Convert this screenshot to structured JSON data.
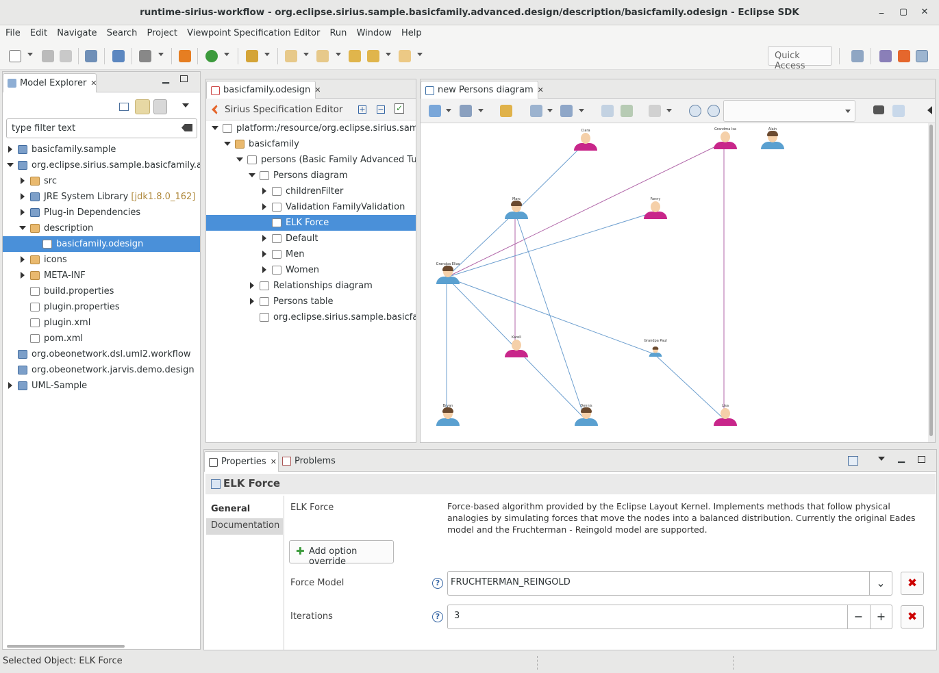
{
  "window": {
    "title": "runtime-sirius-workflow - org.eclipse.sirius.sample.basicfamily.advanced.design/description/basicfamily.odesign - Eclipse SDK",
    "controls": [
      "minimize",
      "maximize",
      "close"
    ]
  },
  "menu": [
    "File",
    "Edit",
    "Navigate",
    "Search",
    "Project",
    "Viewpoint Specification Editor",
    "Run",
    "Window",
    "Help"
  ],
  "toolbar": {
    "quick_access_placeholder": "Quick Access"
  },
  "model_explorer": {
    "tab_label": "Model Explorer",
    "filter_placeholder": "type filter text",
    "tree": [
      {
        "label": "basicfamily.sample",
        "depth": 0,
        "expander": "collapsed",
        "icon": "project-icon"
      },
      {
        "label": "org.eclipse.sirius.sample.basicfamily.advanced",
        "depth": 0,
        "expander": "expanded",
        "icon": "plugin-project-icon"
      },
      {
        "label": "src",
        "depth": 1,
        "expander": "collapsed",
        "icon": "source-folder-icon"
      },
      {
        "label": "JRE System Library",
        "suffix": "[jdk1.8.0_162]",
        "depth": 1,
        "expander": "collapsed",
        "icon": "library-icon"
      },
      {
        "label": "Plug-in Dependencies",
        "depth": 1,
        "expander": "collapsed",
        "icon": "library-icon"
      },
      {
        "label": "description",
        "depth": 1,
        "expander": "expanded",
        "icon": "folder-icon"
      },
      {
        "label": "basicfamily.odesign",
        "depth": 2,
        "expander": "none",
        "icon": "odesign-file-icon",
        "selected": true
      },
      {
        "label": "icons",
        "depth": 1,
        "expander": "collapsed",
        "icon": "folder-icon"
      },
      {
        "label": "META-INF",
        "depth": 1,
        "expander": "collapsed",
        "icon": "folder-icon"
      },
      {
        "label": "build.properties",
        "depth": 1,
        "expander": "none",
        "icon": "properties-file-icon"
      },
      {
        "label": "plugin.properties",
        "depth": 1,
        "expander": "none",
        "icon": "properties-file-icon"
      },
      {
        "label": "plugin.xml",
        "depth": 1,
        "expander": "none",
        "icon": "xml-file-icon"
      },
      {
        "label": "pom.xml",
        "depth": 1,
        "expander": "none",
        "icon": "xml-file-icon"
      },
      {
        "label": "org.obeonetwork.dsl.uml2.workflow",
        "depth": 0,
        "expander": "none",
        "icon": "project-icon"
      },
      {
        "label": "org.obeonetwork.jarvis.demo.design",
        "depth": 0,
        "expander": "none",
        "icon": "project-icon"
      },
      {
        "label": "UML-Sample",
        "depth": 0,
        "expander": "collapsed",
        "icon": "project-icon"
      }
    ]
  },
  "odesign_editor": {
    "tab_label": "basicfamily.odesign",
    "header": "Sirius Specification Editor",
    "tree": [
      {
        "label": "platform:/resource/org.eclipse.sirius.sample.basicfamily.advanced.design/description/basicfamily.odesign",
        "depth": 0,
        "expander": "expanded",
        "icon": "odesign-file-icon"
      },
      {
        "label": "basicfamily",
        "depth": 1,
        "expander": "expanded",
        "icon": "group-folder-icon"
      },
      {
        "label": "persons (Basic Family Advanced Tutorial)",
        "depth": 2,
        "expander": "expanded",
        "icon": "viewpoint-icon"
      },
      {
        "label": "Persons diagram",
        "depth": 3,
        "expander": "expanded",
        "icon": "diagram-description-icon"
      },
      {
        "label": "childrenFilter",
        "depth": 4,
        "expander": "collapsed",
        "icon": "filter-icon"
      },
      {
        "label": "Validation FamilyValidation",
        "depth": 4,
        "expander": "collapsed",
        "icon": "validation-icon"
      },
      {
        "label": "ELK Force",
        "depth": 4,
        "expander": "none",
        "icon": "layout-icon",
        "selected": true
      },
      {
        "label": "Default",
        "depth": 4,
        "expander": "collapsed",
        "icon": "layer-icon"
      },
      {
        "label": "Men",
        "depth": 4,
        "expander": "collapsed",
        "icon": "layer-icon"
      },
      {
        "label": "Women",
        "depth": 4,
        "expander": "collapsed",
        "icon": "layer-icon"
      },
      {
        "label": "Relationships diagram",
        "depth": 3,
        "expander": "collapsed",
        "icon": "diagram-description-icon"
      },
      {
        "label": "Persons table",
        "depth": 3,
        "expander": "collapsed",
        "icon": "table-description-icon"
      },
      {
        "label": "org.eclipse.sirius.sample.basicfamily.advanced.design.Services",
        "depth": 3,
        "expander": "none",
        "icon": "java-extension-icon"
      }
    ]
  },
  "diagram_editor": {
    "tab_label": "new Persons diagram",
    "zoom_combo_value": "",
    "nodes": [
      {
        "id": "n1",
        "label": "Clara",
        "gender": "female"
      },
      {
        "id": "n2",
        "label": "Grandma Isa",
        "gender": "female"
      },
      {
        "id": "n3",
        "label": "Alain",
        "gender": "male"
      },
      {
        "id": "n4",
        "label": "Marc",
        "gender": "male"
      },
      {
        "id": "n5",
        "label": "Fanny",
        "gender": "female"
      },
      {
        "id": "n6",
        "label": "Grandpa Elias",
        "gender": "male"
      },
      {
        "id": "n7",
        "label": "Karell",
        "gender": "female"
      },
      {
        "id": "n8",
        "label": "Grandpa Paul",
        "gender": "male"
      },
      {
        "id": "n9",
        "label": "Bryan",
        "gender": "male"
      },
      {
        "id": "n10",
        "label": "Dennis",
        "gender": "male"
      },
      {
        "id": "n11",
        "label": "Lisa",
        "gender": "female"
      }
    ],
    "edges": [
      {
        "from": "n4",
        "to": "n1",
        "kind": "parent"
      },
      {
        "from": "n6",
        "to": "n2",
        "kind": "spouse"
      },
      {
        "from": "n2",
        "to": "n11",
        "kind": "spouse"
      },
      {
        "from": "n4",
        "to": "n7",
        "kind": "spouse"
      },
      {
        "from": "n6",
        "to": "n5",
        "kind": "parent"
      },
      {
        "from": "n6",
        "to": "n4",
        "kind": "parent"
      },
      {
        "from": "n4",
        "to": "n10",
        "kind": "parent"
      },
      {
        "from": "n6",
        "to": "n9",
        "kind": "parent"
      },
      {
        "from": "n6",
        "to": "n8",
        "kind": "parent"
      },
      {
        "from": "n6",
        "to": "n10",
        "kind": "parent"
      },
      {
        "from": "n8",
        "to": "n11",
        "kind": "parent"
      }
    ]
  },
  "properties_view": {
    "tabs": [
      "Properties",
      "Problems"
    ],
    "title": "ELK Force",
    "side_tabs": [
      "General",
      "Documentation"
    ],
    "algorithm_label": "ELK Force",
    "description": "Force-based algorithm provided by the Eclipse Layout Kernel. Implements methods that follow physical analogies by simulating forces that move the nodes into a balanced distribution. Currently the original Eades model and the Fruchterman - Reingold model are supported.",
    "add_override_label": "Add option override",
    "force_model_label": "Force Model",
    "force_model_value": "FRUCHTERMAN_REINGOLD",
    "iterations_label": "Iterations",
    "iterations_value": "3"
  },
  "status": {
    "text": "Selected Object: ELK Force"
  },
  "colors": {
    "selection": "#4a90d9",
    "male": "#5aa0d0",
    "female": "#c8268a",
    "spouse_edge": "#b065a8",
    "parent_edge": "#6d9fcf"
  }
}
